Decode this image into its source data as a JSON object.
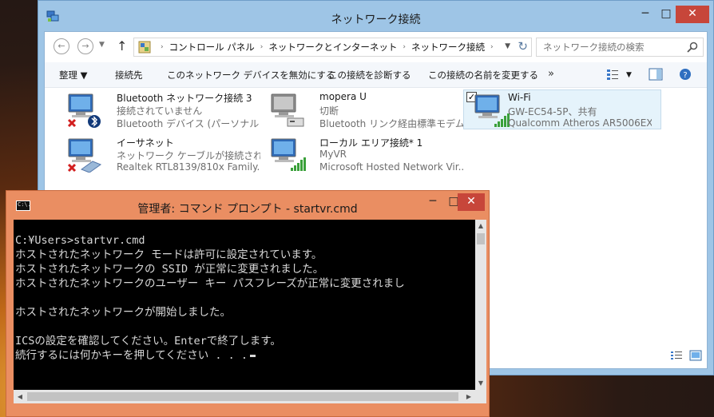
{
  "explorer": {
    "title": "ネットワーク接続",
    "breadcrumb": [
      "コントロール パネル",
      "ネットワークとインターネット",
      "ネットワーク接続"
    ],
    "search_placeholder": "ネットワーク接続の検索",
    "toolbar": {
      "organize": "整理 ▼",
      "connect_to": "接続先",
      "disable": "このネットワーク デバイスを無効にする",
      "diagnose": "この接続を診断する",
      "rename": "この接続の名前を変更する",
      "more": "»"
    },
    "connections": [
      {
        "name": "Bluetooth ネットワーク接続 3",
        "status": "接続されていません",
        "device": "Bluetooth デバイス (パーソナル エ...",
        "icon": "bluetooth-adapter-icon"
      },
      {
        "name": "mopera U",
        "status": "切断",
        "device": "Bluetooth リンク経由標準モデム #3",
        "icon": "modem-icon"
      },
      {
        "name": "Wi-Fi",
        "status": "GW-EC54-5P、共有",
        "device": "Qualcomm Atheros AR5006EX...",
        "icon": "wifi-adapter-icon"
      },
      {
        "name": "イーサネット",
        "status": "ネットワーク ケーブルが接続されていま...",
        "device": "Realtek RTL8139/810x Family...",
        "icon": "ethernet-adapter-icon"
      },
      {
        "name": "ローカル エリア接続* 1",
        "status": "MyVR",
        "device": "Microsoft Hosted Network Vir...",
        "icon": "hosted-network-adapter-icon"
      }
    ]
  },
  "cmd": {
    "title": "管理者: コマンド プロンプト - startvr.cmd",
    "icon_text": "C:\\.",
    "lines": [
      "C:¥Users>startvr.cmd",
      "ホストされたネットワーク モードは許可に設定されています。",
      "ホストされたネットワークの SSID が正常に変更されました。",
      "ホストされたネットワークのユーザー キー パスフレーズが正常に変更されまし",
      "",
      "ホストされたネットワークが開始しました。",
      "",
      "ICSの設定を確認してください。Enterで終了します。",
      "続行するには何かキーを押してください . . ."
    ]
  }
}
